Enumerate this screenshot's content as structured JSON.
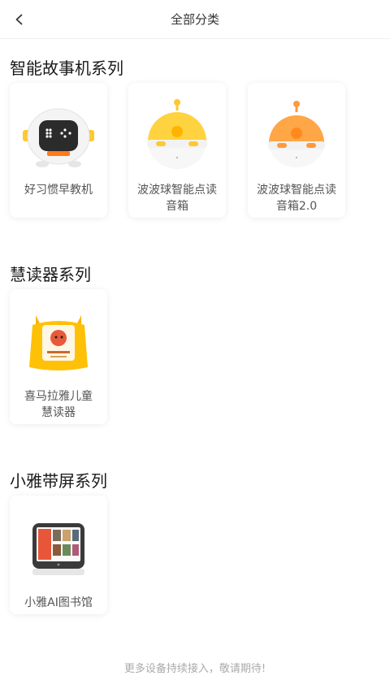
{
  "header": {
    "title": "全部分类"
  },
  "sections": [
    {
      "title": "智能故事机系列",
      "items": [
        {
          "name": "好习惯早教机",
          "icon": "robot-device-icon"
        },
        {
          "name": "波波球智能点读音箱",
          "icon": "yellow-ball-speaker-icon"
        },
        {
          "name": "波波球智能点读音箱2.0",
          "icon": "orange-ball-speaker-icon"
        }
      ]
    },
    {
      "title": "慧读器系列",
      "items": [
        {
          "name": "喜马拉雅儿童慧读器",
          "icon": "cat-reader-icon"
        }
      ]
    },
    {
      "title": "小雅带屏系列",
      "items": [
        {
          "name": "小雅AI图书馆",
          "icon": "screen-device-icon"
        }
      ]
    }
  ],
  "footer": {
    "text": "更多设备持续接入，敬请期待!"
  },
  "colors": {
    "yellow": "#FFC82E",
    "orange": "#FF9A3C",
    "text": "#555555"
  }
}
